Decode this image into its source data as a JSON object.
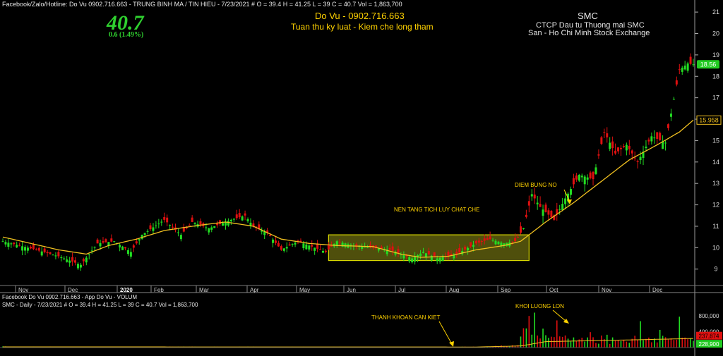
{
  "header": {
    "top_line": "Facebook/Zalo/Hotline: Do Vu 0902.716.663 - TRUNG BINH MA / TIN HIEU    - 7/23/2021   #   O = 39.4  H = 41.25  L = 39  C = 40.7  Vol = 1,863,700",
    "big_price": "40.7",
    "change": "0.6  (1.49%)",
    "center_line1": "Do Vu - 0902.716.663",
    "center_line2": "Tuan thu ky luat - Kiem che long tham",
    "symbol": "SMC",
    "company": "CTCP Dau tu Thuong mai SMC",
    "exchange": "San - Ho Chi Minh Stock Exchange"
  },
  "annotations": {
    "box_label": "NEN TANG TICH LUY CHAT CHE",
    "breakout": "DIEM BUNG NO",
    "dry_volume": "THANH KHOAN CAN KIET",
    "big_volume": "KHOI LUONG LON"
  },
  "volume_panel": {
    "line1": "Facebook Do Vu 0902.716.663 - App Do Vu - VOLUM",
    "line2": "SMC - Daily  - 7/23/2021   #   O = 39.4  H = 41.25  L = 39  C = 40.7  Vol = 1,863,700"
  },
  "colors": {
    "up": "#22dd22",
    "down": "#e01010",
    "ma": "#f0c020",
    "box_fill": "#6a6a10",
    "box_stroke": "#d8d800",
    "tag_bg": "#22cc22"
  },
  "chart_data": {
    "type": "candlestick",
    "x_axis_labels": [
      "Nov",
      "Dec",
      "2020",
      "Feb",
      "Mar",
      "Apr",
      "May",
      "Jun",
      "Jul",
      "Aug",
      "Sep",
      "Oct",
      "Nov",
      "Dec"
    ],
    "y_ticks": [
      9,
      10,
      11,
      12,
      13,
      14,
      15,
      16,
      17,
      18,
      19,
      20,
      21
    ],
    "ylim": [
      8.3,
      21.3
    ],
    "price_tags": {
      "last": "18.56",
      "ma": "15.958"
    },
    "close_path": [
      [
        0,
        10.3
      ],
      [
        12,
        9.9
      ],
      [
        20,
        9.6
      ],
      [
        28,
        9.2
      ],
      [
        34,
        10.2
      ],
      [
        40,
        10.3
      ],
      [
        46,
        9.8
      ],
      [
        50,
        10.6
      ],
      [
        58,
        11.3
      ],
      [
        64,
        10.6
      ],
      [
        68,
        11.2
      ],
      [
        74,
        10.9
      ],
      [
        82,
        11.3
      ],
      [
        87,
        11.5
      ],
      [
        90,
        11.0
      ],
      [
        95,
        10.7
      ],
      [
        100,
        9.9
      ],
      [
        106,
        10.3
      ],
      [
        112,
        10.0
      ],
      [
        116,
        9.8
      ],
      [
        120,
        10.3
      ],
      [
        126,
        10.1
      ],
      [
        133,
        10.0
      ],
      [
        139,
        9.9
      ],
      [
        143,
        9.7
      ],
      [
        147,
        9.5
      ],
      [
        151,
        9.8
      ],
      [
        156,
        9.5
      ],
      [
        163,
        9.7
      ],
      [
        170,
        10.2
      ],
      [
        175,
        10.4
      ],
      [
        180,
        10.2
      ],
      [
        184,
        10.3
      ],
      [
        187,
        10.9
      ],
      [
        190,
        12.5
      ],
      [
        193,
        11.9
      ],
      [
        198,
        11.3
      ],
      [
        202,
        12.3
      ],
      [
        207,
        13.4
      ],
      [
        212,
        13.2
      ],
      [
        216,
        15.4
      ],
      [
        220,
        14.4
      ],
      [
        224,
        14.8
      ],
      [
        228,
        14.0
      ],
      [
        233,
        15.2
      ],
      [
        238,
        14.9
      ],
      [
        243,
        18.3
      ],
      [
        246,
        18.6
      ],
      [
        248,
        18.56
      ]
    ],
    "ma_line": [
      [
        0,
        10.5
      ],
      [
        20,
        9.9
      ],
      [
        30,
        9.7
      ],
      [
        38,
        10.1
      ],
      [
        48,
        10.4
      ],
      [
        58,
        10.8
      ],
      [
        68,
        11.0
      ],
      [
        80,
        11.2
      ],
      [
        90,
        11.0
      ],
      [
        100,
        10.4
      ],
      [
        110,
        10.2
      ],
      [
        120,
        10.1
      ],
      [
        133,
        10.05
      ],
      [
        143,
        9.7
      ],
      [
        150,
        9.55
      ],
      [
        160,
        9.6
      ],
      [
        170,
        9.9
      ],
      [
        180,
        10.1
      ],
      [
        186,
        10.3
      ],
      [
        195,
        11.2
      ],
      [
        205,
        12.1
      ],
      [
        215,
        13.1
      ],
      [
        225,
        14.1
      ],
      [
        235,
        14.8
      ],
      [
        243,
        15.4
      ],
      [
        248,
        15.958
      ]
    ],
    "accumulation_box": {
      "x": [
        117,
        189
      ],
      "y": [
        9.4,
        10.6
      ]
    },
    "bars": 249,
    "volume": {
      "y_ticks": [
        {
          "label": "800,000",
          "value": 800000
        },
        {
          "label": "400,000",
          "value": 400000
        }
      ],
      "ylim": [
        0,
        1000000
      ],
      "tags": [
        {
          "label": "237,874",
          "value": 237874,
          "color": "#e01010"
        },
        {
          "label": "228,900",
          "value": 228900,
          "color": "#22cc22"
        }
      ],
      "profile": [
        [
          0,
          20000
        ],
        [
          100,
          15000
        ],
        [
          160,
          12000
        ],
        [
          175,
          20000
        ],
        [
          185,
          70000
        ],
        [
          189,
          800000
        ],
        [
          195,
          210000
        ],
        [
          220,
          230000
        ],
        [
          248,
          240000
        ]
      ]
    }
  }
}
